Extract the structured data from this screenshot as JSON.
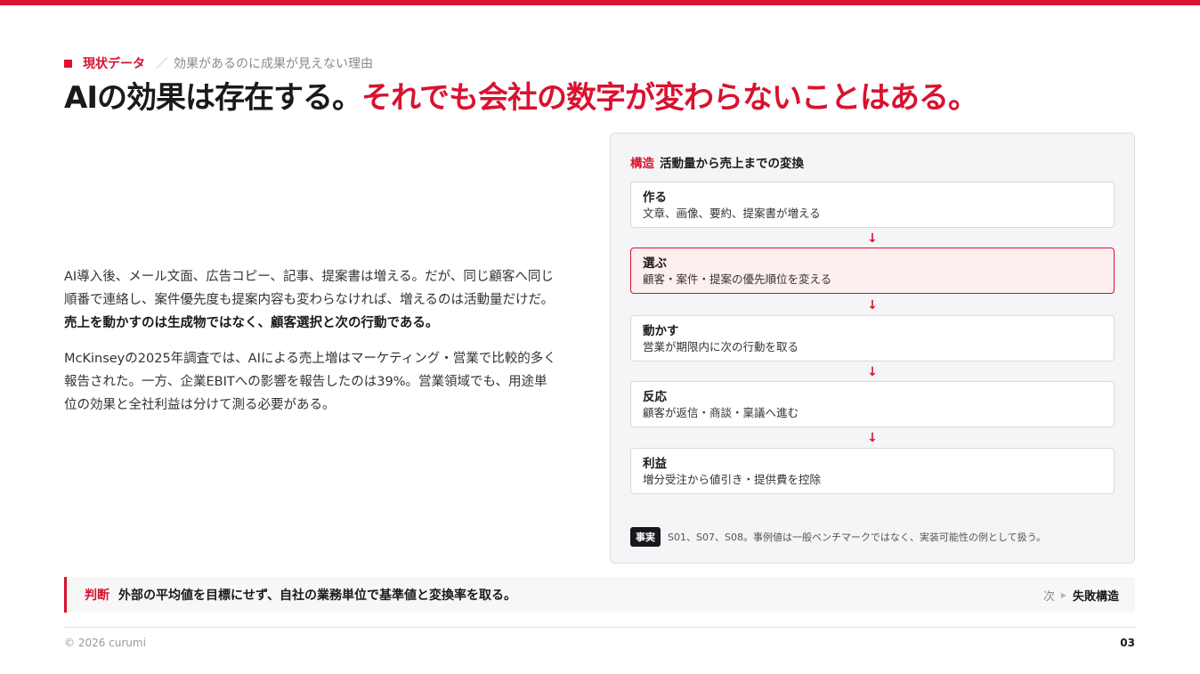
{
  "eyebrow": {
    "tag": "現状データ",
    "separator": "／",
    "subtitle": "効果があるのに成果が見えない理由"
  },
  "headline": {
    "part1": "AIの効果は存在する。",
    "part2": "それでも会社の数字が変わらないことはある。"
  },
  "body": {
    "p1_line1": "AI導入後、メール文面、広告コピー、記事、提案書は増える。だが、同じ顧客へ同じ",
    "p1_line2": "順番で連絡し、案件優先度も提案内容も変わらなければ、増えるのは活動量だけだ。",
    "p1_bold": "売上を動かすのは生成物ではなく、顧客選択と次の行動である。",
    "p2_line1": "McKinseyの2025年調査では、AIによる売上増はマーケティング・営業で比較的多く",
    "p2_line2": "報告された。一方、企業EBITへの影響を報告したのは39%。営業領域でも、用途単",
    "p2_line3": "位の効果と全社利益は分けて測る必要がある。"
  },
  "panel": {
    "keyword": "構造",
    "title": "活動量から売上までの変換",
    "arrow": "↓",
    "steps": [
      {
        "title": "作る",
        "desc": "文章、画像、要約、提案書が増える"
      },
      {
        "title": "選ぶ",
        "desc": "顧客・案件・提案の優先順位を変える"
      },
      {
        "title": "動かす",
        "desc": "営業が期限内に次の行動を取る"
      },
      {
        "title": "反応",
        "desc": "顧客が返信・商談・稟議へ進む"
      },
      {
        "title": "利益",
        "desc": "増分受注から値引き・提供費を控除"
      }
    ],
    "fact_badge": "事実",
    "fact_text": "S01、S07、S08。事例値は一般ベンチマークではなく、実装可能性の例として扱う。"
  },
  "judgment": {
    "label": "判断",
    "text": "外部の平均値を目標にせず、自社の業務単位で基準値と変換率を取る。",
    "next_label": "次",
    "next_value": "失敗構造"
  },
  "footer": {
    "copyright": "© 2026 curumi",
    "page": "03"
  },
  "colors": {
    "accent": "#d9122f",
    "dark": "#16181d",
    "panel_bg": "#f5f5f7"
  }
}
